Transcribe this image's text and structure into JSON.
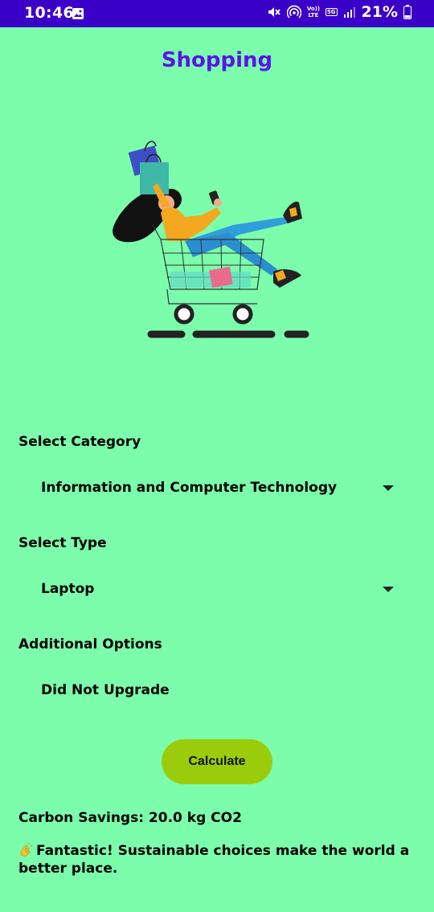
{
  "status_bar": {
    "time": "10:46",
    "battery": "21%",
    "icons": [
      "gallery-icon",
      "mute-icon",
      "hotspot-icon",
      "volte-icon",
      "5g-icon",
      "signal-icon",
      "battery-icon"
    ],
    "volte_label": "Vo)) LTE",
    "fiveg_label": "5G"
  },
  "header": {
    "title": "Shopping",
    "title_color": "#5b14e8"
  },
  "form": {
    "category_label": "Select Category",
    "category_value": "Information and Computer Technology",
    "type_label": "Select Type",
    "type_value": "Laptop",
    "options_label": "Additional Options",
    "options_value": "Did Not Upgrade"
  },
  "actions": {
    "calculate_label": "Calculate",
    "button_color": "#9bcc0c"
  },
  "result": {
    "savings_text": "Carbon Savings: 20.0 kg CO2",
    "message_text": "Fantastic! Sustainable choices make the world a better place.",
    "message_icon": "clapping-hands-icon"
  },
  "colors": {
    "background": "#7bfdab",
    "status_bar": "#3b00c8"
  }
}
